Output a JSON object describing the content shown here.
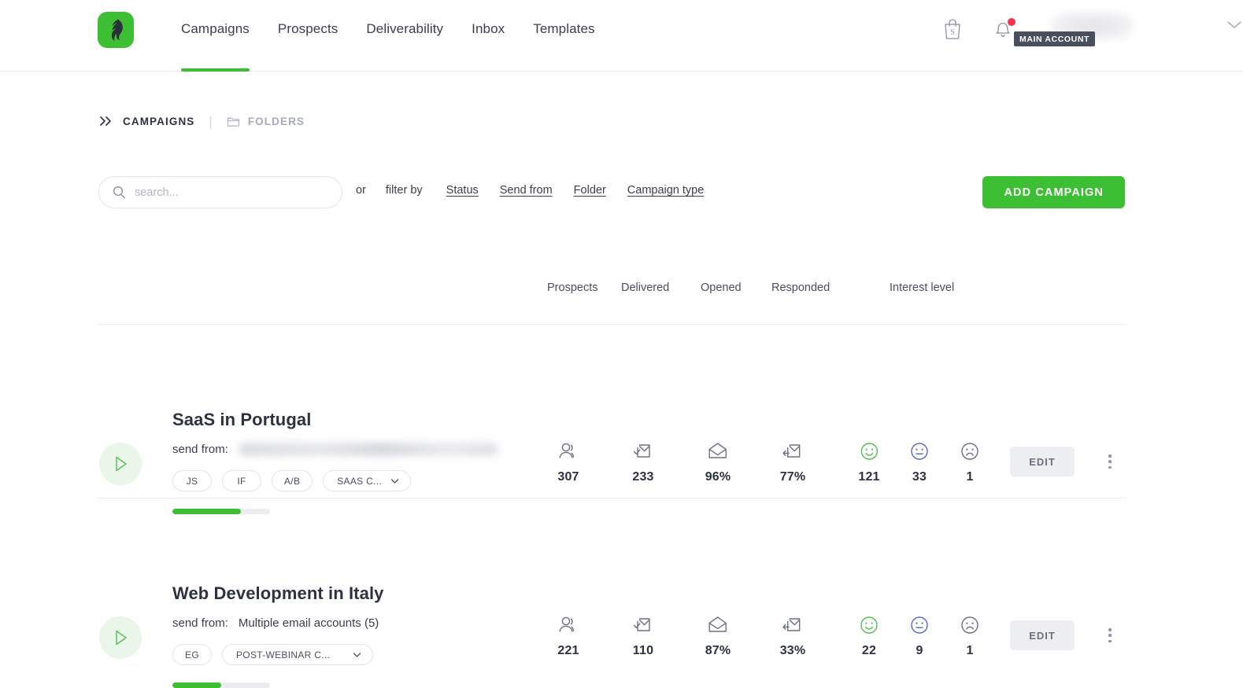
{
  "brand": {
    "logo_icon": "feather-logo-icon",
    "accent_color": "#3cbf33"
  },
  "header": {
    "nav": [
      {
        "label": "Campaigns",
        "active": true
      },
      {
        "label": "Prospects",
        "active": false
      },
      {
        "label": "Deliverability",
        "active": false
      },
      {
        "label": "Inbox",
        "active": false
      },
      {
        "label": "Templates",
        "active": false
      }
    ],
    "shop_icon": "shopping-bag-icon",
    "bell_icon": "notification-bell-icon",
    "account_badge": "MAIN ACCOUNT",
    "account_name_redacted": "",
    "chevron_icon": "chevron-down-icon"
  },
  "breadcrumb": {
    "campaigns_label": "CAMPAIGNS",
    "campaigns_icon": "double-chevron-icon",
    "separator": "|",
    "folders_label": "FOLDERS",
    "folders_icon": "folder-icon"
  },
  "toolbar": {
    "search_placeholder": "search...",
    "search_value": "",
    "search_icon": "search-icon",
    "or_label": "or",
    "filter_by_label": "filter by",
    "filters": [
      "Status",
      "Send from",
      "Folder",
      "Campaign type"
    ],
    "add_campaign_label": "ADD CAMPAIGN"
  },
  "table": {
    "columns": [
      "Prospects",
      "Delivered",
      "Opened",
      "Responded",
      "Interest level"
    ],
    "rows": [
      {
        "title": "SaaS in Portugal",
        "send_from_label": "send from:",
        "send_from_value": "",
        "send_from_redacted": true,
        "tags": [
          "JS",
          "IF",
          "A/B"
        ],
        "folder_tag": "SAAS C...",
        "progress_percent": 70,
        "prospects": "307",
        "delivered": "233",
        "opened": "96%",
        "responded": "77%",
        "interest_positive": "121",
        "interest_neutral": "33",
        "interest_negative": "1",
        "edit_label": "EDIT"
      },
      {
        "title": "Web Development in Italy",
        "send_from_label": "send from:",
        "send_from_value": "Multiple email accounts (5)",
        "send_from_redacted": false,
        "tags": [
          "EG"
        ],
        "folder_tag": "POST-WEBINAR C...",
        "progress_percent": 50,
        "prospects": "221",
        "delivered": "110",
        "opened": "87%",
        "responded": "33%",
        "interest_positive": "22",
        "interest_neutral": "9",
        "interest_negative": "1",
        "edit_label": "EDIT"
      }
    ]
  }
}
